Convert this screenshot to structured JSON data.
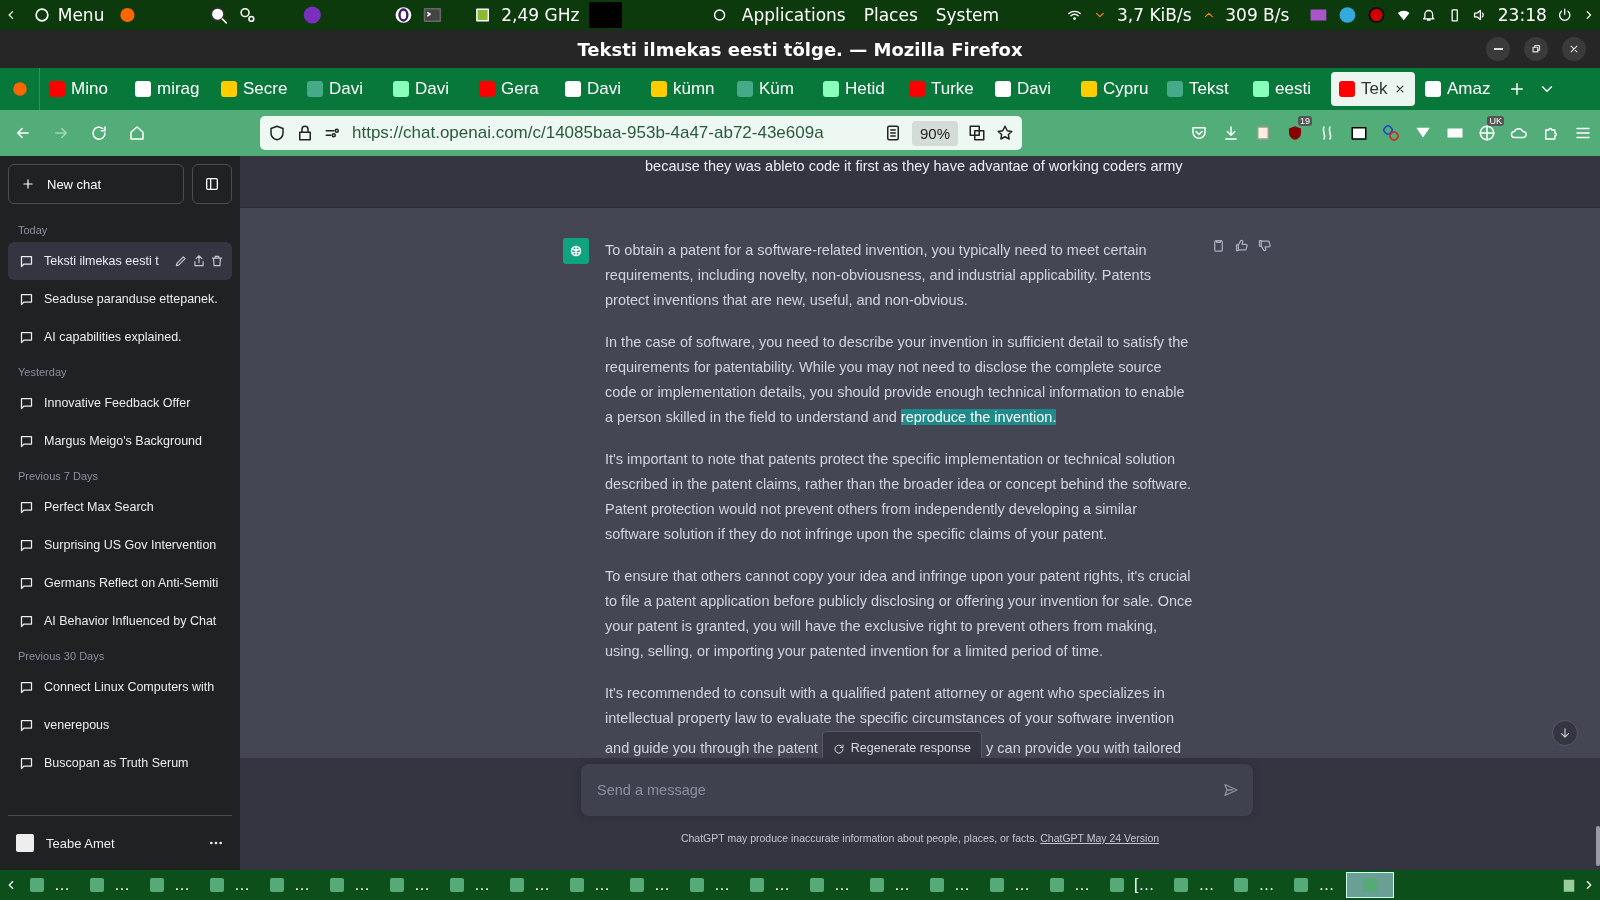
{
  "top_panel": {
    "menu": "Menu",
    "cpu": "2,49 GHz",
    "menus": [
      "Applications",
      "Places",
      "System"
    ],
    "net_down": "3,7 KiB/s",
    "net_up": "309 B/s",
    "clock": "23:18"
  },
  "window": {
    "title": "Teksti ilmekas eesti tõlge. — Mozilla Firefox"
  },
  "tabs": [
    {
      "label": "Mino",
      "selected": false
    },
    {
      "label": "mirag",
      "selected": false
    },
    {
      "label": "Secre",
      "selected": false
    },
    {
      "label": "Davi",
      "selected": false
    },
    {
      "label": "Davi",
      "selected": false
    },
    {
      "label": "Gera",
      "selected": false
    },
    {
      "label": "Davi",
      "selected": false
    },
    {
      "label": "kümn",
      "selected": false
    },
    {
      "label": "Küm",
      "selected": false
    },
    {
      "label": "Hetid",
      "selected": false
    },
    {
      "label": "Turke",
      "selected": false
    },
    {
      "label": "Davi",
      "selected": false
    },
    {
      "label": "Cypru",
      "selected": false
    },
    {
      "label": "Tekst",
      "selected": false
    },
    {
      "label": "eesti",
      "selected": false
    },
    {
      "label": "Tek",
      "selected": true
    },
    {
      "label": "Amaz",
      "selected": false
    }
  ],
  "toolbar": {
    "url": "https://chat.openai.com/c/14085baa-953b-4a47-ab72-43e609a",
    "zoom": "90%",
    "badges": [
      "19",
      "UK"
    ]
  },
  "sidebar": {
    "new_chat": "New chat",
    "groups": [
      {
        "label": "Today",
        "items": [
          {
            "title": "Teksti ilmekas eesti t",
            "selected": true
          },
          {
            "title": "Seaduse paranduse ettepanek.",
            "selected": false
          },
          {
            "title": "AI capabilities explained.",
            "selected": false
          }
        ]
      },
      {
        "label": "Yesterday",
        "items": [
          {
            "title": "Innovative Feedback Offer",
            "selected": false
          },
          {
            "title": "Margus Meigo's Background",
            "selected": false
          }
        ]
      },
      {
        "label": "Previous 7 Days",
        "items": [
          {
            "title": "Perfect Max Search",
            "selected": false
          },
          {
            "title": "Surprising US Gov Intervention",
            "selected": false
          },
          {
            "title": "Germans Reflect on Anti-Semiti",
            "selected": false
          },
          {
            "title": "AI Behavior Influenced by Chat",
            "selected": false
          }
        ]
      },
      {
        "label": "Previous 30 Days",
        "items": [
          {
            "title": "Connect Linux Computers with",
            "selected": false
          },
          {
            "title": "venerepous",
            "selected": false
          },
          {
            "title": "Buscopan as Truth Serum",
            "selected": false
          }
        ]
      }
    ],
    "account": "Teabe Amet"
  },
  "chat": {
    "user_message": "because they was ableto code it first as they have advantae of working coders army",
    "paragraphs": [
      [
        {
          "text": "To obtain a patent for a software-related invention, you typically need to meet certain requirements, including novelty, non-obviousness, and industrial applicability. Patents protect inventions that are new, useful, and non-obvious.",
          "highlighted": false
        }
      ],
      [
        {
          "text": "In the case of software, you need to describe your invention in sufficient detail to satisfy the requirements for patentability. While you may not need to disclose the complete source code or implementation details, you should provide enough technical information to enable a person skilled in the field to understand and ",
          "highlighted": false
        },
        {
          "text": "reproduce the invention.",
          "highlighted": true
        }
      ],
      [
        {
          "text": "It's important to note that patents protect the specific implementation or technical solution described in the patent claims, rather than the broader idea or concept behind the software. Patent protection would not prevent others from independently developing a similar software solution if they do not infringe upon the specific claims of your patent.",
          "highlighted": false
        }
      ],
      [
        {
          "text": "To ensure that others cannot copy your idea and infringe upon your patent rights, it's crucial to file a patent application before publicly disclosing or offering your invention for sale. Once your patent is granted, you will have the exclusive right to prevent others from making, using, selling, or importing your patented invention for a limited period of time.",
          "highlighted": false
        }
      ]
    ],
    "last_lines": [
      "It's recommended to consult with a qualified patent attorney or agent who specializes in",
      "intellectual property law to evaluate the specific circumstances of your software invention"
    ],
    "last_line_left": "and guide you through the patent",
    "last_line_right": "y can provide you with tailored",
    "regenerate": "Regenerate response",
    "input": {
      "placeholder": "Send a message"
    },
    "footer": "ChatGPT may produce inaccurate information about people, places, or facts.",
    "footer_link": "ChatGPT May 24 Version"
  },
  "taskbar": {
    "items": [
      {
        "label": "…",
        "selected": false
      },
      {
        "label": "…",
        "selected": false
      },
      {
        "label": "…",
        "selected": false
      },
      {
        "label": "…",
        "selected": false
      },
      {
        "label": "…",
        "selected": false
      },
      {
        "label": "…",
        "selected": false
      },
      {
        "label": "…",
        "selected": false
      },
      {
        "label": "…",
        "selected": false
      },
      {
        "label": "…",
        "selected": false
      },
      {
        "label": "…",
        "selected": false
      },
      {
        "label": "…",
        "selected": false
      },
      {
        "label": "…",
        "selected": false
      },
      {
        "label": "…",
        "selected": false
      },
      {
        "label": "…",
        "selected": false
      },
      {
        "label": "…",
        "selected": false
      },
      {
        "label": "…",
        "selected": false
      },
      {
        "label": "…",
        "selected": false
      },
      {
        "label": "…",
        "selected": false
      },
      {
        "label": "[…",
        "selected": false
      },
      {
        "label": "…",
        "selected": false
      },
      {
        "label": "…",
        "selected": false
      },
      {
        "label": "…",
        "selected": false
      },
      {
        "selected": true
      }
    ]
  }
}
